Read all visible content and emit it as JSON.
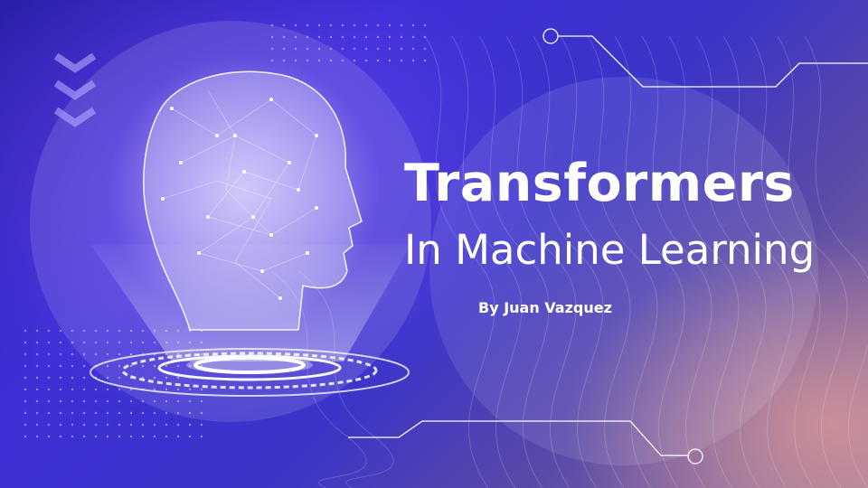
{
  "slide": {
    "title": "Transformers",
    "subtitle": "In Machine Learning",
    "author": "By Juan Vazquez"
  },
  "colors": {
    "background_primary": "#3d2fd6",
    "background_accent": "#d69696",
    "text": "#ffffff"
  },
  "icons": [
    "chevron-down-icon",
    "hologram-head-illustration",
    "circuit-line-decoration"
  ]
}
